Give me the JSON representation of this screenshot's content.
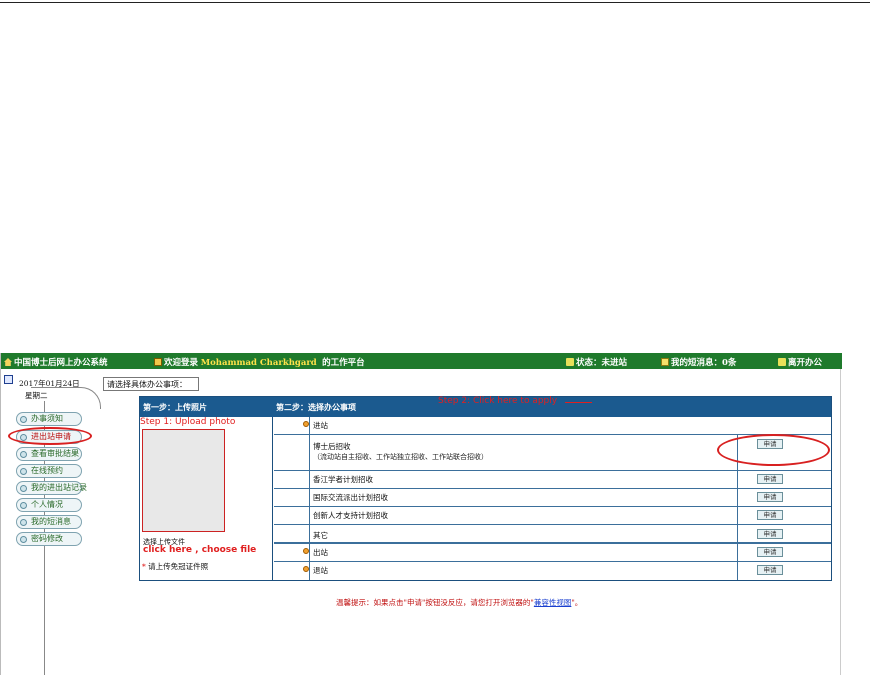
{
  "topbar": {
    "system_name": "中国博士后网上办公系统",
    "welcome_prefix": "欢迎登录",
    "user_name": "Mohammad Charkhgard",
    "welcome_suffix": "的工作平台",
    "status": "状态：未进站",
    "messages": "我的短消息：0条",
    "logout": "离开办公"
  },
  "date": {
    "date": "2017年01月24日",
    "weekday": "星期二"
  },
  "sidebar": {
    "items": [
      {
        "label": "办事须知"
      },
      {
        "label": "进出站申请"
      },
      {
        "label": "查看审批结果"
      },
      {
        "label": "在线预约"
      },
      {
        "label": "我的进出站记录"
      },
      {
        "label": "个人情况"
      },
      {
        "label": "我的短消息"
      },
      {
        "label": "密码修改"
      }
    ]
  },
  "main": {
    "prompt": "请选择具体办公事项：",
    "step1_header": "第一步：上传照片",
    "step2_header": "第二步：选择办公事项",
    "annotation_step1": "Step 1: Upload photo",
    "upload_button": "选择上传文件",
    "annotation_choose": "click here , choose file",
    "cert_note_mark": "*",
    "cert_note": "请上传免冠证件照",
    "annotation_step2": "Step 2: Click here to apply",
    "rows": [
      {
        "label": "进站",
        "sub": "",
        "button": ""
      },
      {
        "label": "博士后招收",
        "sub": "（流动站自主招收、工作站独立招收、工作站联合招收）",
        "button": "申请"
      },
      {
        "label": "香江学者计划招收",
        "sub": "",
        "button": "申请"
      },
      {
        "label": "国际交流派出计划招收",
        "sub": "",
        "button": "申请"
      },
      {
        "label": "创新人才支持计划招收",
        "sub": "",
        "button": "申请"
      },
      {
        "label": "其它",
        "sub": "",
        "button": "申请"
      },
      {
        "label": "出站",
        "sub": "",
        "button": "申请"
      },
      {
        "label": "退站",
        "sub": "",
        "button": "申请"
      }
    ],
    "tip_prefix": "温馨提示：如果点击\"申请\"按钮没反应，请您打开浏览器的\"",
    "tip_link": "兼容性视图",
    "tip_suffix": "\"。"
  },
  "colors": {
    "topbar": "#1f7a2c",
    "panel_header": "#1b5a8f",
    "annotation": "#e02020"
  }
}
